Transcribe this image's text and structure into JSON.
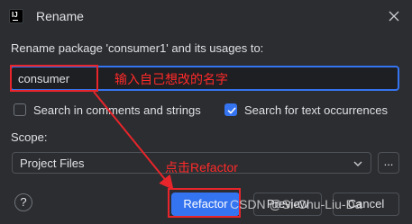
{
  "window": {
    "title": "Rename",
    "app_icon": "intellij-icon",
    "close_icon": "close-icon"
  },
  "description": "Rename package 'consumer1' and its usages to:",
  "name_input": {
    "value": "consumer"
  },
  "options": {
    "search_comments": {
      "label": "Search in comments and strings",
      "checked": false
    },
    "search_text": {
      "label": "Search for text occurrences",
      "checked": true
    }
  },
  "scope": {
    "label": "Scope:",
    "selected": "Project Files",
    "more_label": "..."
  },
  "buttons": {
    "help": "?",
    "refactor": "Refactor",
    "preview": "Preview",
    "cancel": "Cancel"
  },
  "annotations": {
    "input_note": "输入自己想改的名字",
    "refactor_note": "点击Refactor",
    "watermark": "CSDN @Si-Chu-Liu-Da"
  },
  "colors": {
    "background": "#2b2d30",
    "accent": "#3574f0",
    "annotation": "#e8252b"
  }
}
